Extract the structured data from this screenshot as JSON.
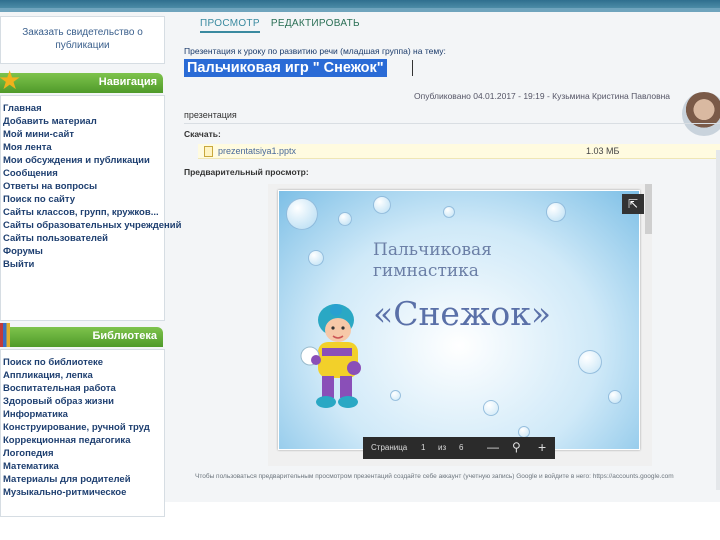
{
  "sidebar": {
    "order_box": "Заказать свидетельство о публикации",
    "navigation": {
      "title": "Навигация",
      "items": [
        "Главная",
        "Добавить материал",
        "Мой мини-сайт",
        "Моя лента",
        "Мои обсуждения и публикации",
        "Сообщения",
        "Ответы на вопросы",
        "Поиск по сайту",
        "Сайты классов, групп, кружков...",
        "Сайты образовательных учреждений",
        "Сайты пользователей",
        "Форумы",
        "Выйти"
      ]
    },
    "library": {
      "title": "Библиотека",
      "items": [
        "Поиск по библиотеке",
        "Аппликация, лепка",
        "Воспитательная работа",
        "Здоровый образ жизни",
        "Информатика",
        "Конструирование, ручной труд",
        "Коррекционная педагогика",
        "Логопедия",
        "Математика",
        "Материалы для родителей",
        "Музыкально-ритмическое"
      ]
    }
  },
  "tabs": {
    "view": "ПРОСМОТР",
    "edit": "РЕДАКТИРОВАТЬ"
  },
  "post": {
    "subtitle": "Презентация к уроку по развитию речи (младшая группа) на тему:",
    "title": "Пальчиковая игр \" Снежок\"",
    "meta": "Опубликовано 04.01.2017 - 19:19 - Кузьмина Кристина Павловна",
    "description": "презентация",
    "download_label": "Скачать:",
    "file": {
      "name": "prezentatsiya1.pptx",
      "size": "1.03 МБ"
    },
    "preview_label": "Предварительный просмотр:",
    "footnote": "Чтобы пользоваться предварительным просмотром презентаций создайте себе аккаунт (учетную запись) Google и войдите в него: https://accounts.google.com"
  },
  "slide": {
    "line1": "Пальчиковая",
    "line2": "гимнастика",
    "line3": "«Снежок»"
  },
  "viewer_toolbar": {
    "page_label": "Страница",
    "page": "1",
    "of": "из",
    "total": "6",
    "minus": "—",
    "zoom_icon": "⚲",
    "plus": "+"
  },
  "colors": {
    "nav_green": "#5ba830",
    "title_highlight": "#2a6bd6",
    "link": "#1e3f70"
  }
}
